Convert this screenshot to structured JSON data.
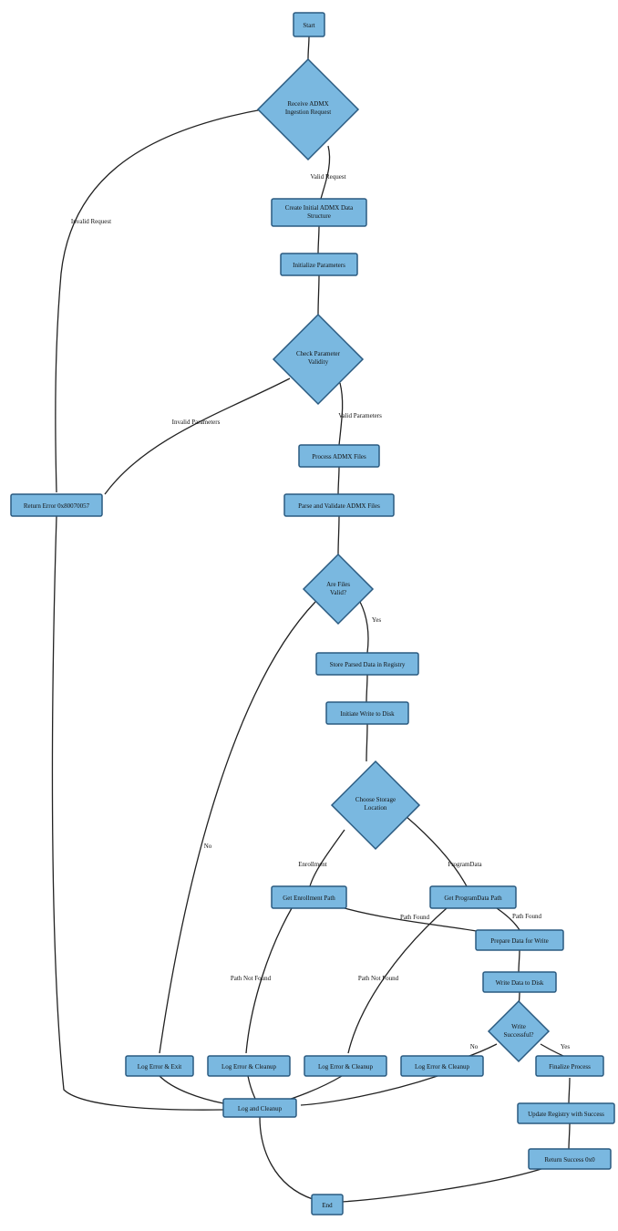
{
  "diagram": {
    "type": "flowchart",
    "style": "hand-drawn",
    "colors": {
      "nodeFill": "#7ab8e0",
      "nodeStroke": "#2a5a80",
      "edge": "#222222",
      "bg": "#ffffff"
    },
    "nodes": {
      "start": {
        "shape": "rect",
        "label": "Start"
      },
      "receive": {
        "shape": "diamond",
        "label": "Receive ADMX\nIngestion Request"
      },
      "createInit": {
        "shape": "rect",
        "label": "Create Initial ADMX Data\nStructure"
      },
      "initParams": {
        "shape": "rect",
        "label": "Initialize Parameters"
      },
      "checkParams": {
        "shape": "diamond",
        "label": "Check Parameter\nValidity"
      },
      "retErr": {
        "shape": "rect",
        "label": "Return Error 0x80070057"
      },
      "process": {
        "shape": "rect",
        "label": "Process ADMX Files"
      },
      "parse": {
        "shape": "rect",
        "label": "Parse and Validate ADMX Files"
      },
      "filesValid": {
        "shape": "diamond",
        "label": "Are Files\nValid?"
      },
      "store": {
        "shape": "rect",
        "label": "Store Parsed Data in Registry"
      },
      "initiate": {
        "shape": "rect",
        "label": "Initiate Write to Disk"
      },
      "choose": {
        "shape": "diamond",
        "label": "Choose Storage\nLocation"
      },
      "getEnroll": {
        "shape": "rect",
        "label": "Get Enrollment Path"
      },
      "getProg": {
        "shape": "rect",
        "label": "Get ProgramData Path"
      },
      "prepare": {
        "shape": "rect",
        "label": "Prepare Data for Write"
      },
      "writeDisk": {
        "shape": "rect",
        "label": "Write Data to Disk"
      },
      "writeOk": {
        "shape": "diamond",
        "label": "Write\nSuccessful?"
      },
      "logExit": {
        "shape": "rect",
        "label": "Log Error & Exit"
      },
      "logClean1": {
        "shape": "rect",
        "label": "Log Error & Cleanup"
      },
      "logClean2": {
        "shape": "rect",
        "label": "Log Error & Cleanup"
      },
      "logClean3": {
        "shape": "rect",
        "label": "Log Error & Cleanup"
      },
      "finalize": {
        "shape": "rect",
        "label": "Finalize Process"
      },
      "logCleanup": {
        "shape": "rect",
        "label": "Log and Cleanup"
      },
      "updateReg": {
        "shape": "rect",
        "label": "Update Registry with Success"
      },
      "retOk": {
        "shape": "rect",
        "label": "Return Success 0x0"
      },
      "end": {
        "shape": "rect",
        "label": "End"
      }
    },
    "edges": [
      {
        "from": "start",
        "to": "receive",
        "label": ""
      },
      {
        "from": "receive",
        "to": "createInit",
        "label": "Valid Request"
      },
      {
        "from": "receive",
        "to": "retErr",
        "label": "Invalid Request"
      },
      {
        "from": "createInit",
        "to": "initParams",
        "label": ""
      },
      {
        "from": "initParams",
        "to": "checkParams",
        "label": ""
      },
      {
        "from": "checkParams",
        "to": "process",
        "label": "Valid Parameters"
      },
      {
        "from": "checkParams",
        "to": "retErr",
        "label": "Invalid Parameters"
      },
      {
        "from": "process",
        "to": "parse",
        "label": ""
      },
      {
        "from": "parse",
        "to": "filesValid",
        "label": ""
      },
      {
        "from": "filesValid",
        "to": "store",
        "label": "Yes"
      },
      {
        "from": "filesValid",
        "to": "logExit",
        "label": "No"
      },
      {
        "from": "store",
        "to": "initiate",
        "label": ""
      },
      {
        "from": "initiate",
        "to": "choose",
        "label": ""
      },
      {
        "from": "choose",
        "to": "getEnroll",
        "label": "Enrollment"
      },
      {
        "from": "choose",
        "to": "getProg",
        "label": "ProgramData"
      },
      {
        "from": "getEnroll",
        "to": "prepare",
        "label": "Path Found"
      },
      {
        "from": "getEnroll",
        "to": "logClean1",
        "label": "Path Not Found"
      },
      {
        "from": "getProg",
        "to": "prepare",
        "label": "Path Found"
      },
      {
        "from": "getProg",
        "to": "logClean2",
        "label": "Path Not Found"
      },
      {
        "from": "prepare",
        "to": "writeDisk",
        "label": ""
      },
      {
        "from": "writeDisk",
        "to": "writeOk",
        "label": ""
      },
      {
        "from": "writeOk",
        "to": "finalize",
        "label": "Yes"
      },
      {
        "from": "writeOk",
        "to": "logClean3",
        "label": "No"
      },
      {
        "from": "logExit",
        "to": "logCleanup",
        "label": ""
      },
      {
        "from": "logClean1",
        "to": "logCleanup",
        "label": ""
      },
      {
        "from": "logClean2",
        "to": "logCleanup",
        "label": ""
      },
      {
        "from": "logClean3",
        "to": "logCleanup",
        "label": ""
      },
      {
        "from": "retErr",
        "to": "logCleanup",
        "label": ""
      },
      {
        "from": "finalize",
        "to": "updateReg",
        "label": ""
      },
      {
        "from": "updateReg",
        "to": "retOk",
        "label": ""
      },
      {
        "from": "logCleanup",
        "to": "end",
        "label": ""
      },
      {
        "from": "retOk",
        "to": "end",
        "label": ""
      }
    ]
  }
}
